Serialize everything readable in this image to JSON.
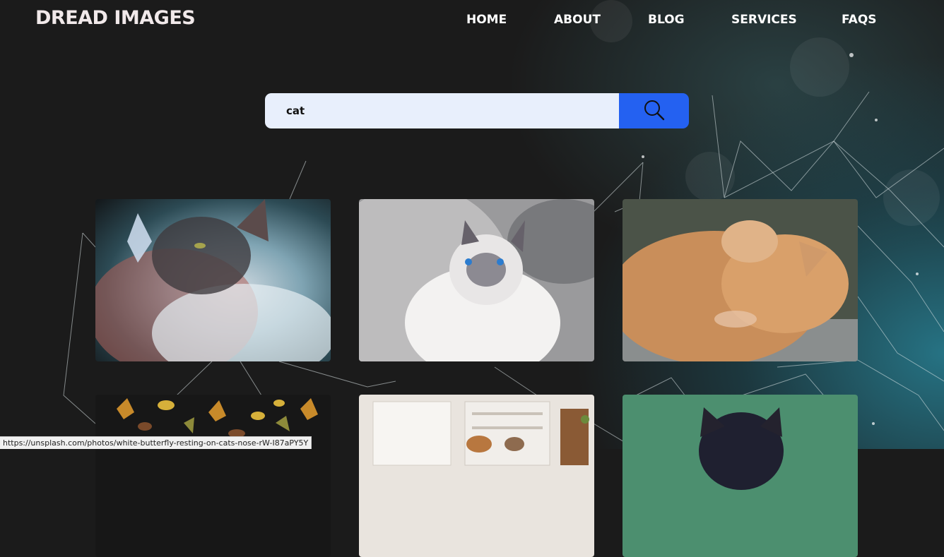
{
  "brand": {
    "logo_text": "DREAD IMAGES"
  },
  "nav": {
    "items": [
      {
        "label": "HOME"
      },
      {
        "label": "ABOUT"
      },
      {
        "label": "BLOG"
      },
      {
        "label": "SERVICES"
      },
      {
        "label": "FAQS"
      }
    ]
  },
  "search": {
    "value": "cat",
    "button_icon": "search-icon"
  },
  "gallery": {
    "images": [
      {
        "subject": "white-butterfly-on-cat-nose"
      },
      {
        "subject": "siamese-cat-looking-up"
      },
      {
        "subject": "orange-cat-sleeping"
      },
      {
        "subject": "autumn-leaves-flatlay"
      },
      {
        "subject": "cat-in-kitchen"
      },
      {
        "subject": "black-white-cat-green-wall"
      }
    ]
  },
  "status_bar": {
    "url": "https://unsplash.com/photos/white-butterfly-resting-on-cats-nose-rW-I87aPY5Y"
  },
  "colors": {
    "accent": "#2461f1",
    "background": "#1b1b1b",
    "search_field": "#e8effc"
  }
}
